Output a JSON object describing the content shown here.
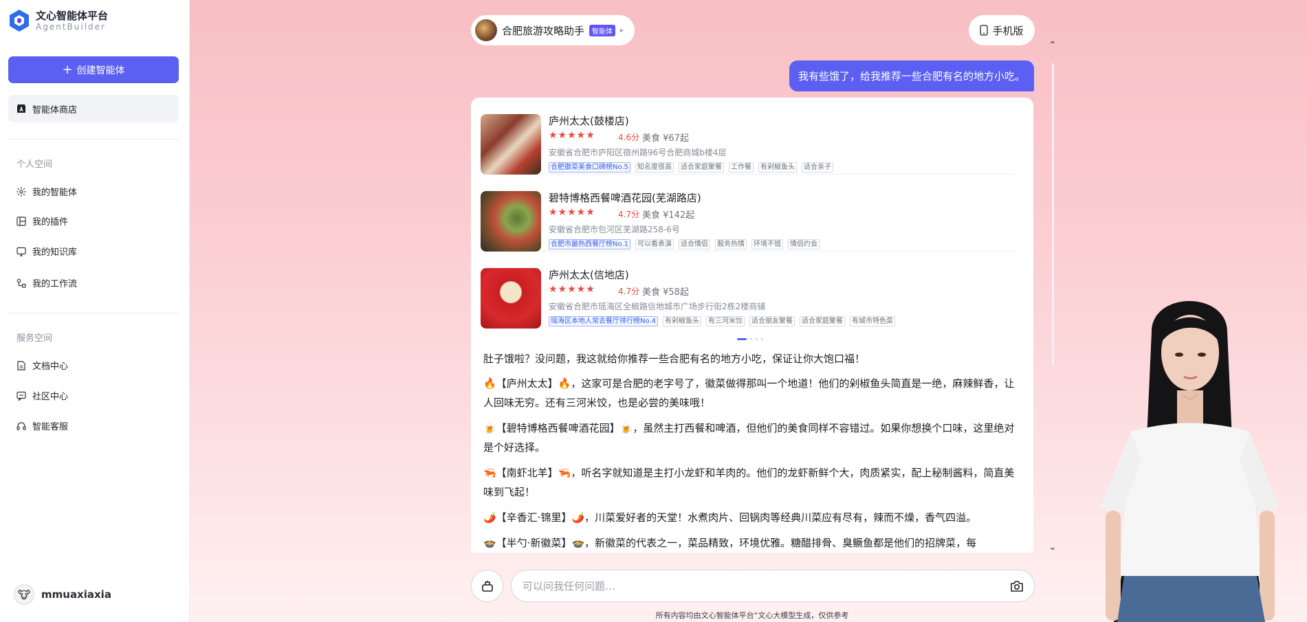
{
  "sidebar": {
    "logo_title": "文心智能体平台",
    "logo_subtitle": "AgentBuilder",
    "create_label": "创建智能体",
    "store_label": "智能体商店",
    "personal_title": "个人空间",
    "personal_items": [
      "我的智能体",
      "我的插件",
      "我的知识库",
      "我的工作流"
    ],
    "service_title": "服务空间",
    "service_items": [
      "文档中心",
      "社区中心",
      "智能客服"
    ],
    "username": "mmuaxiaxia"
  },
  "header": {
    "agent_name": "合肥旅游攻略助手",
    "agent_badge": "智能体",
    "mobile_label": "手机版"
  },
  "user_message": "我有些饿了，给我推荐一些合肥有名的地方小吃。",
  "restaurants": [
    {
      "name": "庐州太太(鼓楼店)",
      "score": "4.6分",
      "price": "美食 ¥67起",
      "address": "安徽省合肥市庐阳区宿州路96号合肥商城b楼4层",
      "tags": [
        "合肥徽菜美食口碑榜No.5",
        "知名度很高",
        "适合家庭聚餐",
        "工作餐",
        "有剁椒鱼头",
        "适合亲子"
      ]
    },
    {
      "name": "碧特博格西餐啤酒花园(芜湖路店)",
      "score": "4.7分",
      "price": "美食 ¥142起",
      "address": "安徽省合肥市包河区芜湖路258-6号",
      "tags": [
        "合肥市最热西餐厅榜No.1",
        "可以看表演",
        "适合情侣",
        "服务热情",
        "环境不错",
        "情侣约会"
      ]
    },
    {
      "name": "庐州太太(信地店)",
      "score": "4.7分",
      "price": "美食 ¥58起",
      "address": "安徽省合肥市瑶海区全椒路信地城市广场步行街2栋2楼商铺",
      "tags": [
        "瑶海区本地人常去餐厅排行榜No.4",
        "有剁椒鱼头",
        "有三河米饺",
        "适合朋友聚餐",
        "适合家庭聚餐",
        "有城市特色菜"
      ]
    }
  ],
  "reply": {
    "intro": "肚子饿啦？没问题，我这就给你推荐一些合肥有名的地方小吃，保证让你大饱口福！",
    "p1": "🔥【庐州太太】🔥，这家可是合肥的老字号了，徽菜做得那叫一个地道！他们的剁椒鱼头简直是一绝，麻辣鲜香，让人回味无穷。还有三河米饺，也是必尝的美味哦！",
    "p2": "🍺【碧特博格西餐啤酒花园】🍺，虽然主打西餐和啤酒，但他们的美食同样不容错过。如果你想换个口味，这里绝对是个好选择。",
    "p3": "🦐【南虾北羊】🦐，听名字就知道是主打小龙虾和羊肉的。他们的龙虾新鲜个大，肉质紧实，配上秘制酱料，简直美味到飞起！",
    "p4": "🌶️【辛香汇·锦里】🌶️，川菜爱好者的天堂！水煮肉片、回锅肉等经典川菜应有尽有，辣而不燥，香气四溢。",
    "p5": "🍲【半勺·新徽菜】🍲，新徽菜的代表之一，菜品精致，环境优雅。糖醋排骨、臭鳜鱼都是他们的招牌菜，每"
  },
  "input": {
    "placeholder": "可以问我任何问题…"
  },
  "footer": "所有内容均由文心智能体平台“文心大模型生成，仅供参考",
  "colors": {
    "accent": "#5b5ff2",
    "rating": "#f0463c",
    "background_top": "#f8bfc4"
  },
  "icons": [
    "logo-icon",
    "plus-icon",
    "store-icon",
    "sparkle-icon",
    "plugin-icon",
    "knowledge-icon",
    "workflow-icon",
    "doc-icon",
    "community-icon",
    "headset-icon",
    "phone-icon",
    "camera-icon",
    "star-icon",
    "chevron-up-icon",
    "chevron-down-icon"
  ]
}
